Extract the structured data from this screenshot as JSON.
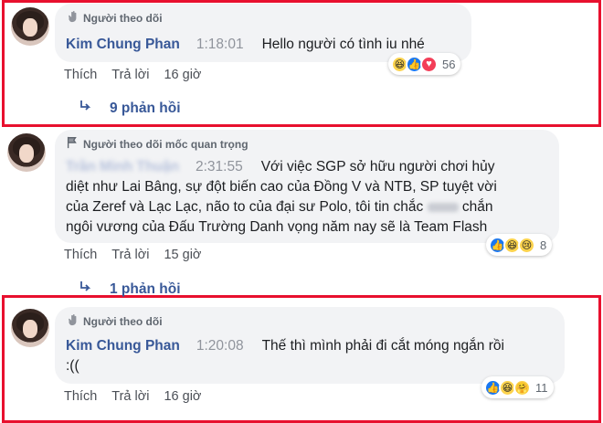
{
  "comments": [
    {
      "tag": "Người theo dõi",
      "author": "Kim Chung Phan",
      "time": "1:18:01",
      "lines": [
        "Hello người có tình iu nhé"
      ],
      "actions": {
        "like": "Thích",
        "reply": "Trả lời",
        "age": "16 giờ"
      },
      "reactions": {
        "types": [
          "haha-icon",
          "like-icon",
          "love-icon"
        ],
        "count": "56"
      },
      "replies": "9 phản hồi"
    },
    {
      "tag": "Người theo dõi mốc quan trọng",
      "author": "Trần Minh Thuận",
      "time": "2:31:55",
      "lines": [
        "Với việc SGP sở hữu người chơi hủy",
        "diệt như Lai Bâng, sự đột biến cao của Đồng V và NTB, SP tuyệt vời",
        "của Zeref và Lạc Lạc, não to của đại sư Polo, tôi tin chắc",
        "chắn",
        "ngôi vương của Đấu Trường Danh vọng năm nay sẽ là Team Flash"
      ],
      "actions": {
        "like": "Thích",
        "reply": "Trả lời",
        "age": "15 giờ"
      },
      "reactions": {
        "types": [
          "like-icon",
          "haha-icon",
          "sad-icon"
        ],
        "count": "8"
      },
      "replies": "1 phản hồi"
    },
    {
      "tag": "Người theo dõi",
      "author": "Kim Chung Phan",
      "time": "1:20:08",
      "lines": [
        "Thế thì mình phải đi cắt móng ngắn rồi",
        ":(("
      ],
      "actions": {
        "like": "Thích",
        "reply": "Trả lời",
        "age": "16 giờ"
      },
      "reactions": {
        "types": [
          "like-icon",
          "haha-icon",
          "care-icon"
        ],
        "count": "11"
      }
    }
  ],
  "colors": {
    "highlight": "#e8102e",
    "link": "#385898",
    "bubble": "#f2f3f5"
  }
}
